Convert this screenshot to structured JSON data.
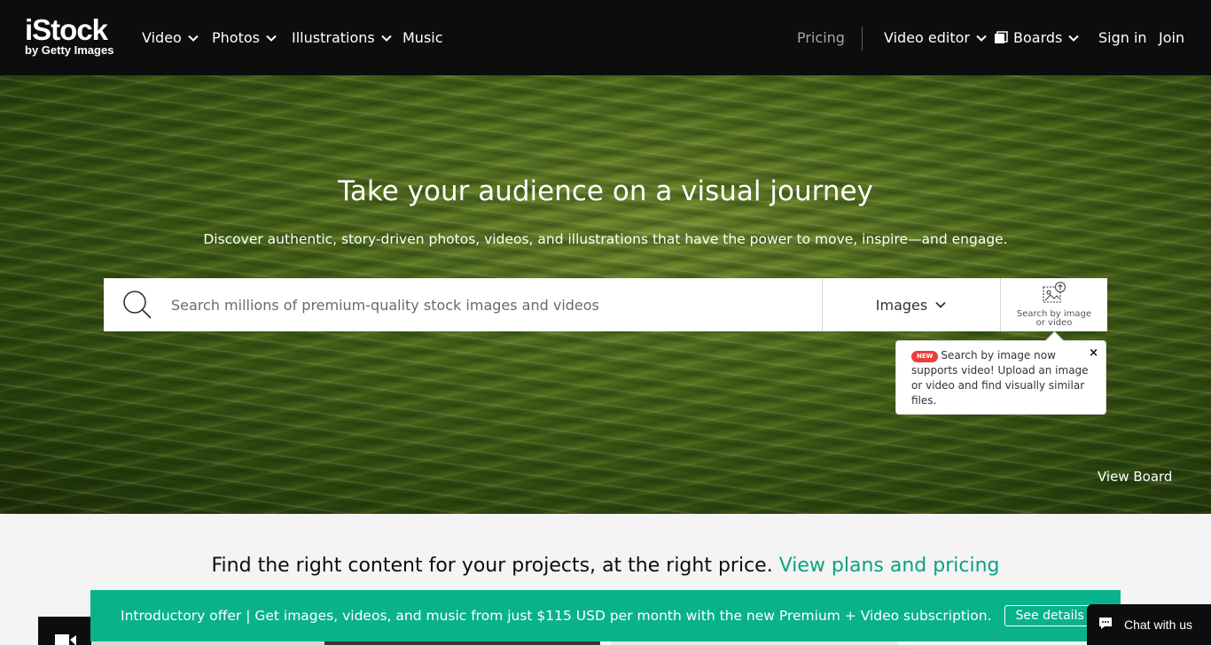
{
  "header": {
    "logo": {
      "wordmark": "iStock",
      "byline": "by Getty Images"
    },
    "nav_left": [
      {
        "label": "Video"
      },
      {
        "label": "Photos"
      },
      {
        "label": "Illustrations"
      },
      {
        "label": "Music"
      }
    ],
    "nav_right": {
      "pricing": "Pricing",
      "video_editor": "Video editor",
      "boards": "Boards",
      "sign_in": "Sign in",
      "join": "Join"
    }
  },
  "hero": {
    "title": "Take your audience on a visual journey",
    "subtitle": "Discover authentic, story-driven photos, videos, and illustrations that have the power to move, inspire—and engage.",
    "search": {
      "placeholder": "Search millions of premium-quality stock images and videos",
      "value": "",
      "media_type": "Images",
      "image_search_label": "Search by image or video"
    },
    "tooltip": {
      "badge": "NEW",
      "text": "Search by image now supports video! Upload an image or video and find visually similar files.",
      "close": "×"
    },
    "view_board": "View Board"
  },
  "promo": {
    "heading": "Find the right content for your projects, at the right price.",
    "link": "View plans and pricing"
  },
  "offer": {
    "text": "Introductory offer | Get images, videos, and music from just $115 USD per month with the new Premium + Video subscription.",
    "button": "See details"
  },
  "chat": {
    "label": "Chat with us"
  },
  "colors": {
    "topbar": "#0c0d0d",
    "accent": "#0ab28b",
    "link": "#08a37f",
    "badge": "#e8403b"
  }
}
